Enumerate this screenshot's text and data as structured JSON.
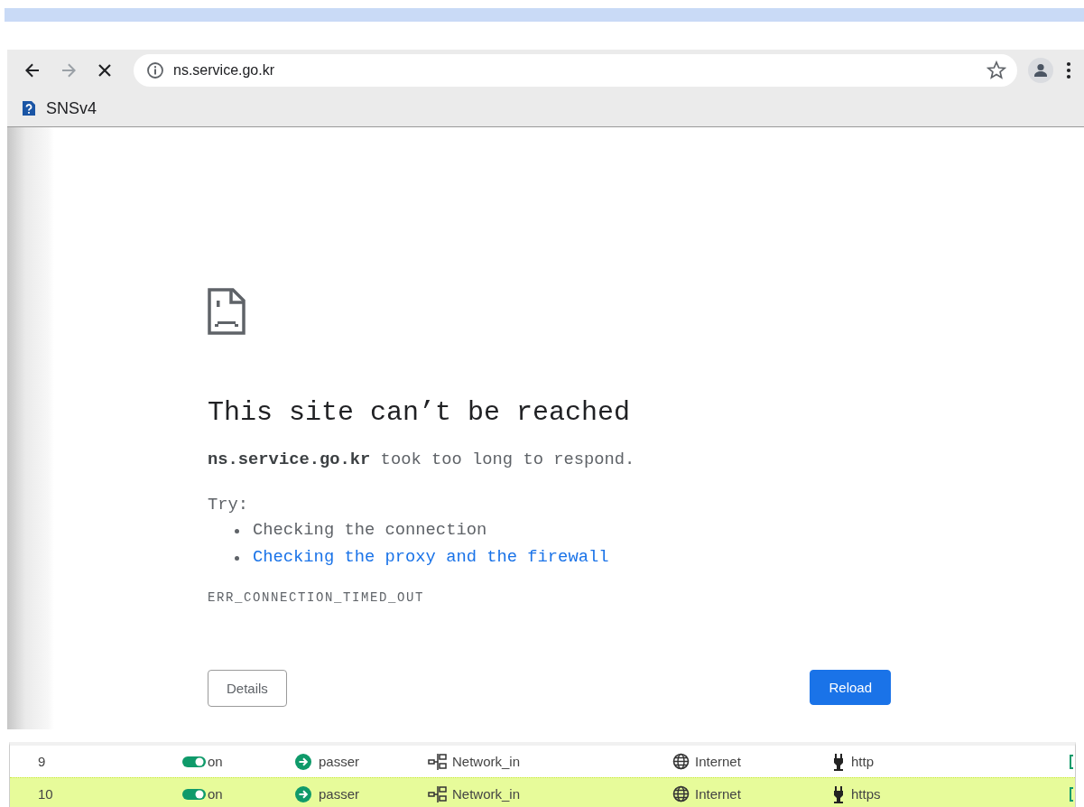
{
  "toolbar": {
    "nav": [
      {
        "kind": "back",
        "disabled": false
      },
      {
        "kind": "forward",
        "disabled": true
      },
      {
        "kind": "stop",
        "disabled": false
      }
    ],
    "url": "ns.service.go.kr",
    "bookmarked": false
  },
  "bookmarks": [
    {
      "label": "SNSv4"
    }
  ],
  "error_page": {
    "title": "This site can’t be reached",
    "message": "**ns.service.go.kr** took too long to respond.",
    "try_label": "Try:",
    "suggestions": [
      {
        "text": "Checking the connection",
        "kind": "text"
      },
      {
        "text": "Checking the proxy and the firewall",
        "kind": "link"
      }
    ],
    "error_code": "ERR_CONNECTION_TIMED_OUT",
    "buttons": [
      {
        "label": "Details",
        "kind": "secondary"
      },
      {
        "label": "Reload",
        "kind": "primary"
      }
    ]
  },
  "table": {
    "rows": [
      {
        "column_1": "9",
        "on": true,
        "column_2": "on",
        "action": "passer",
        "source": "Network_in",
        "destination": "Internet",
        "service": "http",
        "selected": false
      },
      {
        "column_1": "10",
        "on": true,
        "column_2": "on",
        "action": "passer",
        "source": "Network_in",
        "destination": "Internet",
        "service": "https",
        "selected": true
      }
    ]
  }
}
